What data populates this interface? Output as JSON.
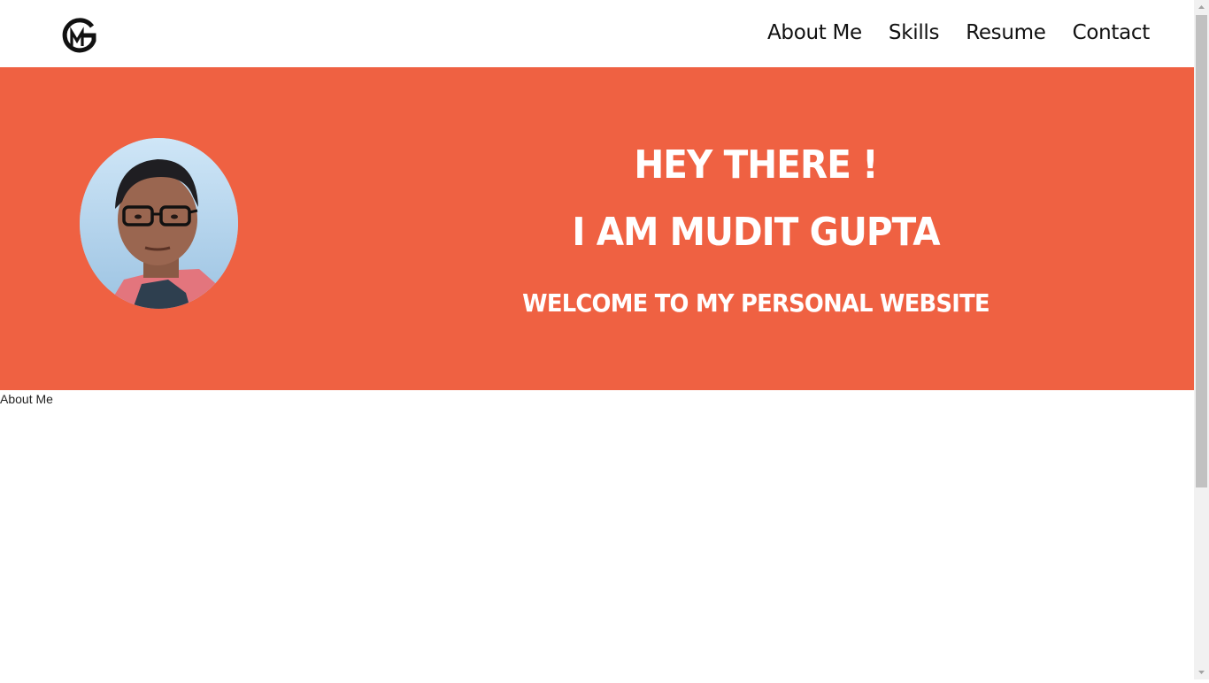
{
  "header": {
    "logo_icon": "mg-monogram-logo",
    "nav": [
      {
        "label": "About Me"
      },
      {
        "label": "Skills"
      },
      {
        "label": "Resume"
      },
      {
        "label": "Contact"
      }
    ]
  },
  "hero": {
    "background_color": "#ef6142",
    "line1": "Hey there !",
    "line2": "I am Mudit Gupta",
    "subtitle": "Welcome to my personal website",
    "avatar_icon": "profile-photo"
  },
  "main": {
    "section_label": "About Me"
  }
}
